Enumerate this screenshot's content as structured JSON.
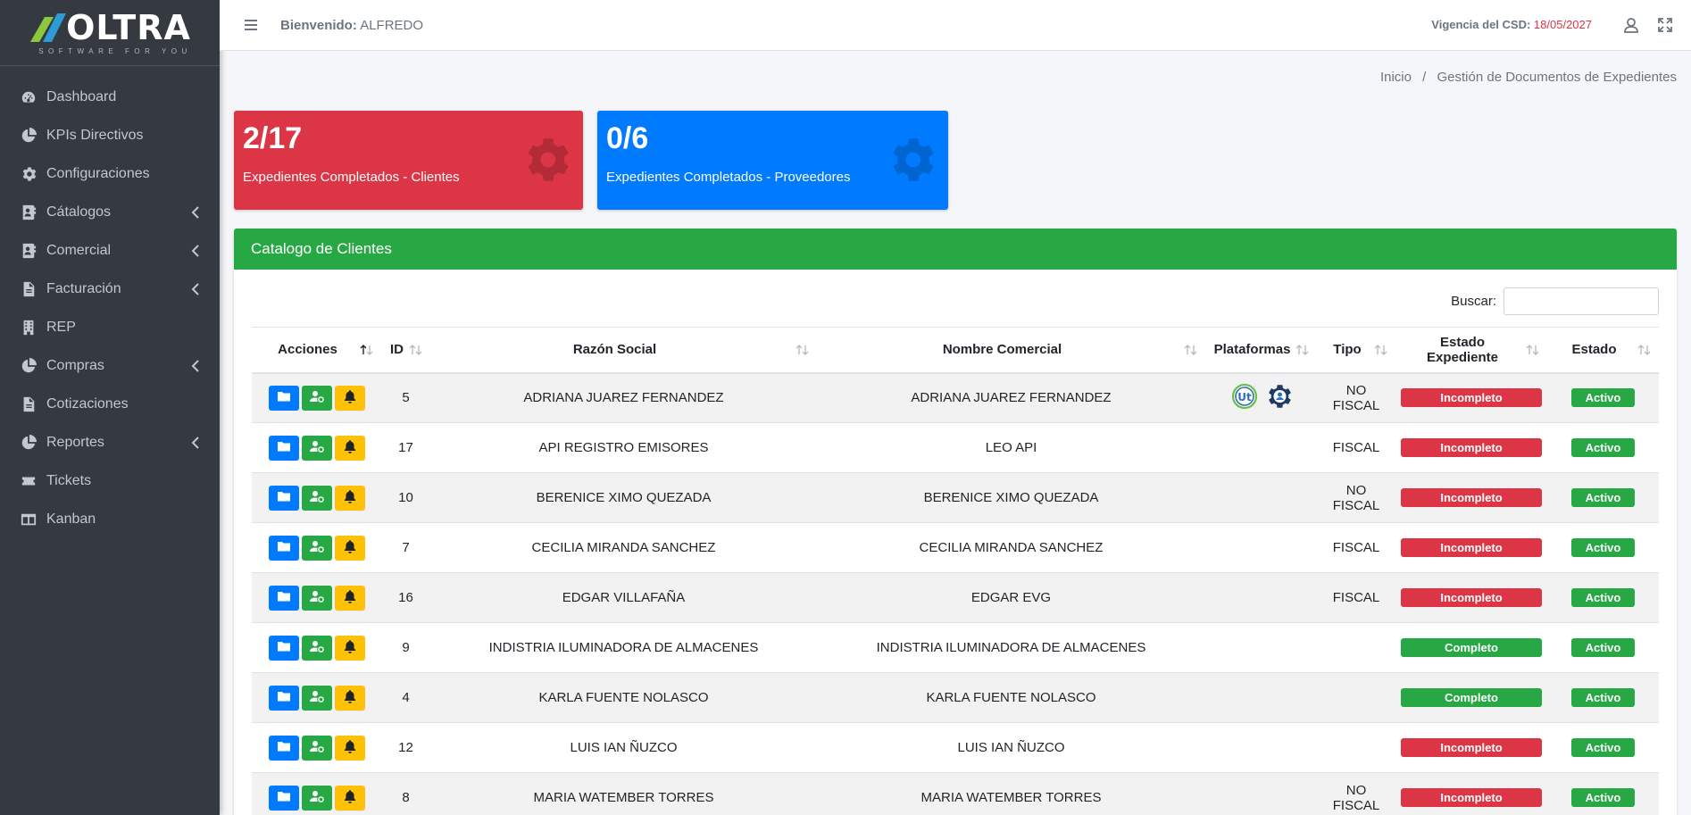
{
  "brand": {
    "name": "OLTRA",
    "tagline": "SOFTWARE FOR YOU"
  },
  "sidebar": {
    "items": [
      {
        "label": "Dashboard",
        "icon": "dashboard-gauge-icon",
        "has_children": false
      },
      {
        "label": "KPIs Directivos",
        "icon": "pie-chart-icon",
        "has_children": false
      },
      {
        "label": "Configuraciones",
        "icon": "gear-icon",
        "has_children": false
      },
      {
        "label": "Cátalogos",
        "icon": "address-book-icon",
        "has_children": true
      },
      {
        "label": "Comercial",
        "icon": "address-book-icon",
        "has_children": true
      },
      {
        "label": "Facturación",
        "icon": "invoice-icon",
        "has_children": true
      },
      {
        "label": "REP",
        "icon": "building-icon",
        "has_children": false
      },
      {
        "label": "Compras",
        "icon": "pie-chart-icon",
        "has_children": true
      },
      {
        "label": "Cotizaciones",
        "icon": "document-icon",
        "has_children": false
      },
      {
        "label": "Reportes",
        "icon": "pie-chart-icon",
        "has_children": true
      },
      {
        "label": "Tickets",
        "icon": "ticket-icon",
        "has_children": false
      },
      {
        "label": "Kanban",
        "icon": "columns-icon",
        "has_children": false
      }
    ]
  },
  "topbar": {
    "welcome_label": "Bienvenido:",
    "user": "ALFREDO",
    "vigencia_label": "Vigencia del CSD:",
    "vigencia_date": "18/05/2027"
  },
  "breadcrumb": {
    "home": "Inicio",
    "current": "Gestión de Documentos de Expedientes"
  },
  "stats": {
    "clientes": {
      "value": "2/17",
      "label": "Expedientes Completados - Clientes"
    },
    "proveedores": {
      "value": "0/6",
      "label": "Expedientes Completados - Proveedores"
    }
  },
  "card": {
    "title": "Catalogo de Clientes",
    "search_label": "Buscar:",
    "search_value": ""
  },
  "table": {
    "headers": [
      "Acciones",
      "ID",
      "Razón Social",
      "Nombre Comercial",
      "Plataformas",
      "Tipo",
      "Estado Expediente",
      "Estado"
    ],
    "rows": [
      {
        "id": "5",
        "razon": "ADRIANA JUAREZ FERNANDEZ",
        "comercial": "ADRIANA JUAREZ FERNANDEZ",
        "plataformas": true,
        "tipo": "NO FISCAL",
        "expediente": "Incompleto",
        "estado": "Activo"
      },
      {
        "id": "17",
        "razon": "API REGISTRO EMISORES",
        "comercial": "LEO API",
        "plataformas": false,
        "tipo": "FISCAL",
        "expediente": "Incompleto",
        "estado": "Activo"
      },
      {
        "id": "10",
        "razon": "BERENICE XIMO QUEZADA",
        "comercial": "BERENICE XIMO QUEZADA",
        "plataformas": false,
        "tipo": "NO FISCAL",
        "expediente": "Incompleto",
        "estado": "Activo"
      },
      {
        "id": "7",
        "razon": "CECILIA MIRANDA SANCHEZ",
        "comercial": "CECILIA MIRANDA SANCHEZ",
        "plataformas": false,
        "tipo": "FISCAL",
        "expediente": "Incompleto",
        "estado": "Activo"
      },
      {
        "id": "16",
        "razon": "EDGAR VILLAFAÑA",
        "comercial": "EDGAR EVG",
        "plataformas": false,
        "tipo": "FISCAL",
        "expediente": "Incompleto",
        "estado": "Activo"
      },
      {
        "id": "9",
        "razon": "INDISTRIA ILUMINADORA DE ALMACENES",
        "comercial": "INDISTRIA ILUMINADORA DE ALMACENES",
        "plataformas": false,
        "tipo": "",
        "expediente": "Completo",
        "estado": "Activo"
      },
      {
        "id": "4",
        "razon": "KARLA FUENTE NOLASCO",
        "comercial": "KARLA FUENTE NOLASCO",
        "plataformas": false,
        "tipo": "",
        "expediente": "Completo",
        "estado": "Activo"
      },
      {
        "id": "12",
        "razon": "LUIS IAN ÑUZCO",
        "comercial": "LUIS IAN ÑUZCO",
        "plataformas": false,
        "tipo": "",
        "expediente": "Incompleto",
        "estado": "Activo"
      },
      {
        "id": "8",
        "razon": "MARIA WATEMBER TORRES",
        "comercial": "MARIA WATEMBER TORRES",
        "plataformas": false,
        "tipo": "NO FISCAL",
        "expediente": "Incompleto",
        "estado": "Activo"
      }
    ]
  },
  "colors": {
    "sidebar": "#343a40",
    "danger": "#dc3545",
    "primary": "#007bff",
    "success": "#28a745",
    "warning": "#ffc107"
  }
}
